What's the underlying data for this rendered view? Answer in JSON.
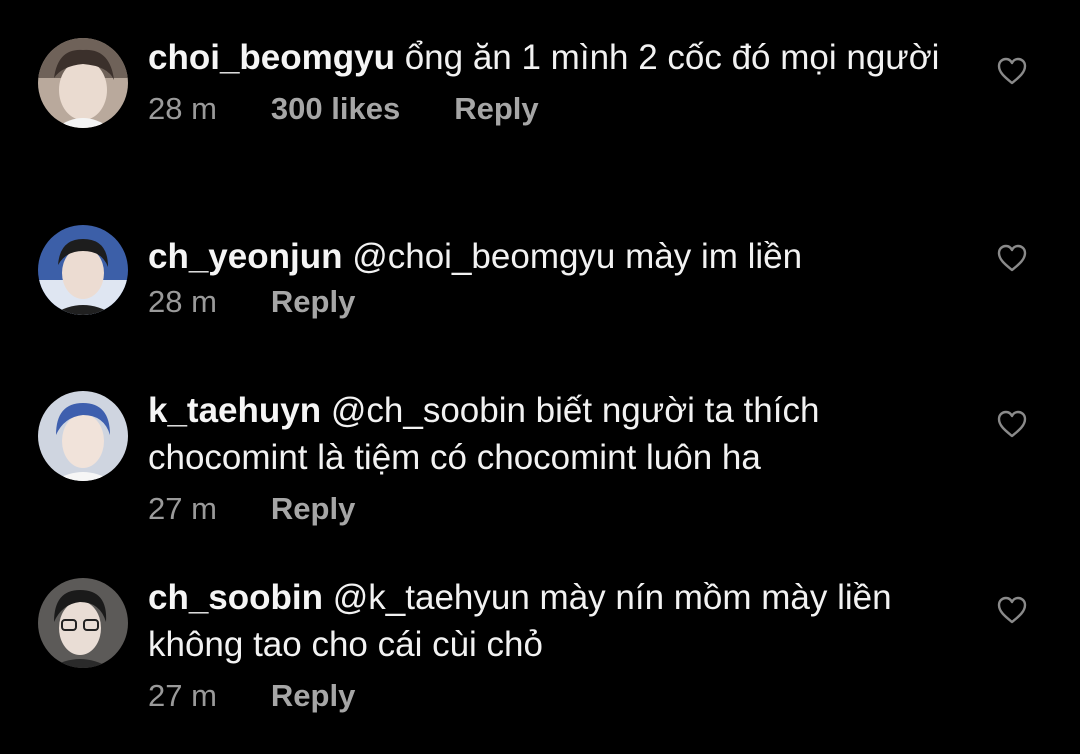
{
  "colors": {
    "background": "#000000",
    "text": "#f2f2f2",
    "muted": "#9a9a9a"
  },
  "comments": [
    {
      "username": "choi_beomgyu",
      "text": "ổng ăn 1 mình 2 cốc đó mọi người",
      "time": "28 m",
      "likes": "300 likes",
      "reply": "Reply",
      "heart_icon": "heart-outline-icon"
    },
    {
      "username": "ch_yeonjun",
      "text": "@choi_beomgyu mày im liền",
      "time": "28 m",
      "reply": "Reply",
      "heart_icon": "heart-outline-icon"
    },
    {
      "username": "k_taehuyn",
      "text": "@ch_soobin biết người ta thích chocomint là tiệm có chocomint luôn ha",
      "time": "27 m",
      "reply": "Reply",
      "heart_icon": "heart-outline-icon"
    },
    {
      "username": "ch_soobin",
      "text": "@k_taehyun mày nín mồm mày liền không tao cho cái cùi chỏ",
      "time": "27 m",
      "reply": "Reply",
      "heart_icon": "heart-outline-icon"
    }
  ]
}
